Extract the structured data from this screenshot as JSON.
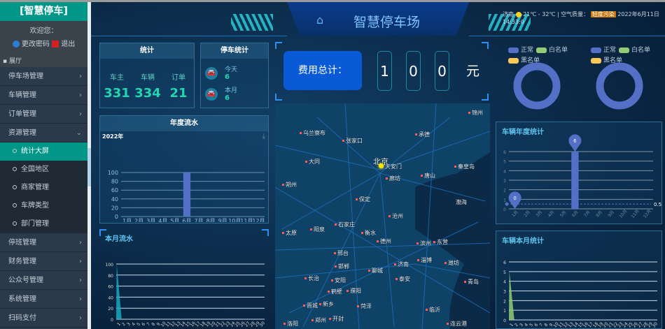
{
  "sidebar": {
    "brand": "[智慧停车]",
    "welcome": "欢迎您：",
    "change_password": "更改密码",
    "logout": "退出",
    "home": "展厅",
    "items": [
      {
        "label": "停车场管理"
      },
      {
        "label": "车辆管理"
      },
      {
        "label": "订单管理"
      },
      {
        "label": "资源管理",
        "expanded": true
      }
    ],
    "subitems": [
      {
        "label": "统计大屏",
        "active": true
      },
      {
        "label": "全国地区"
      },
      {
        "label": "商家管理"
      },
      {
        "label": "车牌类型"
      },
      {
        "label": "部门管理"
      }
    ],
    "items2": [
      {
        "label": "停班管理"
      },
      {
        "label": "财务管理"
      },
      {
        "label": "公众号管理"
      },
      {
        "label": "系统管理"
      },
      {
        "label": "扫码支付"
      }
    ]
  },
  "header": {
    "title": "智慧停车场",
    "city": "济南",
    "temp": "21℃ - 32℃",
    "aqi_label": "空气质量：",
    "aqi": "轻度污染",
    "datetime": "2022年6月11日 14:33:0"
  },
  "stats": {
    "title": "统计",
    "items": [
      {
        "label": "车主",
        "value": "331"
      },
      {
        "label": "车辆",
        "value": "334"
      },
      {
        "label": "订单",
        "value": "21"
      }
    ]
  },
  "parking": {
    "title": "停车统计",
    "items": [
      {
        "label": "今天",
        "value": "6"
      },
      {
        "label": "本月",
        "value": "6"
      }
    ]
  },
  "cost": {
    "label": "费用总计：",
    "digits": [
      "1",
      "0",
      "0"
    ],
    "unit": "元"
  },
  "donuts": [
    {
      "legend": [
        "正常",
        "白名单",
        "黑名单"
      ]
    },
    {
      "legend": [
        "正常",
        "白名单",
        "黑名单"
      ]
    }
  ],
  "colors": {
    "normal": "#5470c6",
    "white": "#91cc75",
    "black": "#fac858",
    "teal": "#009688"
  },
  "map": {
    "cities": [
      "乌兰察布",
      "张家口",
      "承德",
      "大同",
      "北京",
      "天安门",
      "廊坊",
      "唐山",
      "秦皇岛",
      "朔州",
      "保定",
      "渤海",
      "沧州",
      "石家庄",
      "阳泉",
      "太原",
      "衡水",
      "德州",
      "滨州",
      "东营",
      "邢台",
      "济南",
      "淄博",
      "潍坊",
      "邯郸",
      "聊城",
      "泰安",
      "青岛",
      "长治",
      "安阳",
      "濮阳",
      "鹤壁",
      "晋城",
      "新乡",
      "菏泽",
      "临沂",
      "洛阳",
      "郑州",
      "开封",
      "连云港",
      "锦州"
    ]
  },
  "chart_data": [
    {
      "id": "annual",
      "type": "bar",
      "title": "年度流水",
      "subtitle": "2022年",
      "categories": [
        "1月",
        "2月",
        "3月",
        "4月",
        "5月",
        "6月",
        "7月",
        "8月",
        "9月",
        "10月",
        "11月",
        "12月"
      ],
      "values": [
        0,
        0,
        0,
        0,
        0,
        100,
        0,
        0,
        0,
        0,
        0,
        0
      ],
      "ylim": [
        0,
        100
      ],
      "yticks": [
        0,
        20,
        40,
        60,
        80,
        100
      ]
    },
    {
      "id": "monthly",
      "type": "area",
      "title": "本月流水",
      "categories": [
        "1",
        "2",
        "3",
        "4",
        "5",
        "6",
        "7",
        "8",
        "9",
        "10",
        "11",
        "12",
        "13",
        "14",
        "15",
        "16",
        "17",
        "18",
        "19",
        "20",
        "21",
        "22",
        "23",
        "24",
        "25",
        "26",
        "27",
        "28",
        "29",
        "30"
      ],
      "values": [
        100,
        0,
        0,
        0,
        0,
        0,
        0,
        0,
        0,
        0,
        0,
        0,
        0,
        0,
        0,
        0,
        0,
        0,
        0,
        0,
        0,
        0,
        0,
        0,
        0,
        0,
        0,
        0,
        0,
        0
      ],
      "ylim": [
        0,
        100
      ],
      "yticks": [
        0,
        20,
        40,
        60,
        80,
        100
      ]
    },
    {
      "id": "vehicle_annual",
      "type": "bar",
      "title": "车辆年度统计",
      "categories": [
        "1月",
        "2月",
        "3月",
        "4月",
        "5月",
        "6月",
        "7月",
        "8月",
        "9月",
        "10月",
        "11月",
        "12月"
      ],
      "values": [
        0,
        0,
        0,
        0,
        0,
        6,
        0,
        0,
        0,
        0,
        0,
        0
      ],
      "ylim": [
        0,
        6
      ],
      "yticks": [
        0,
        1,
        2,
        3,
        4,
        5,
        6
      ],
      "mark_max": "6",
      "mark_min": "0",
      "mark_avg": "0.5"
    },
    {
      "id": "vehicle_monthly",
      "type": "area",
      "title": "车辆本月统计",
      "categories": [
        "1",
        "2",
        "3",
        "4",
        "5",
        "6",
        "7",
        "8",
        "9",
        "10",
        "11",
        "12",
        "13",
        "14",
        "15",
        "16",
        "17",
        "18",
        "19",
        "20",
        "21",
        "22",
        "23",
        "24",
        "25",
        "26",
        "27",
        "28",
        "29",
        "30"
      ],
      "values": [
        5,
        0,
        0,
        0,
        0,
        0,
        0,
        0,
        0,
        0,
        0,
        0,
        0,
        0,
        0,
        0,
        0,
        0,
        0,
        0,
        0,
        0,
        0,
        0,
        0,
        0,
        0,
        0,
        0,
        0
      ],
      "ylim": [
        0,
        6
      ],
      "yticks": [
        0,
        1,
        2,
        3,
        4,
        5,
        6
      ]
    }
  ]
}
